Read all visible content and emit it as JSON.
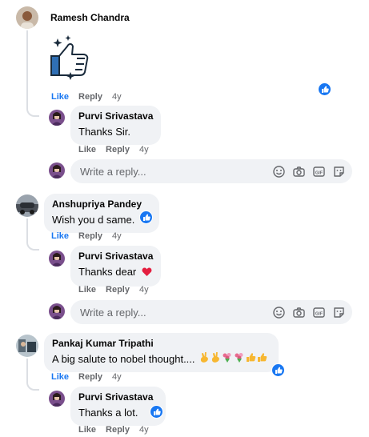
{
  "comments": [
    {
      "author": "Ramesh Chandra",
      "sticker": "thumbs-up-sparkle-sticker",
      "like": "Like",
      "reply": "Reply",
      "time": "4y",
      "replies": [
        {
          "author": "Purvi Srivastava",
          "text": "Thanks Sir.",
          "like": "Like",
          "reply": "Reply",
          "time": "4y"
        }
      ]
    },
    {
      "author": "Anshupriya Pandey",
      "text": "Wish you d same.",
      "like": "Like",
      "reply": "Reply",
      "time": "4y",
      "replies": [
        {
          "author": "Purvi Srivastava",
          "text": "Thanks dear",
          "like": "Like",
          "reply": "Reply",
          "time": "4y"
        }
      ]
    },
    {
      "author": "Pankaj Kumar Tripathi",
      "text": "A big salute to nobel thought....",
      "like": "Like",
      "reply": "Reply",
      "time": "4y",
      "replies": [
        {
          "author": "Purvi Srivastava",
          "text": "Thanks a lot.",
          "like": "Like",
          "reply": "Reply",
          "time": "4y"
        }
      ]
    }
  ],
  "reply_box": {
    "placeholder": "Write a reply..."
  },
  "colors": {
    "link": "#1877f2",
    "bubble": "#f0f2f5",
    "meta": "#65676b",
    "heart": "#e41e3f"
  },
  "icons": [
    "smile-icon",
    "camera-icon",
    "gif-icon",
    "sticker-icon",
    "like-reaction-icon",
    "heart-emoji",
    "victory-hand-emoji",
    "bouquet-emoji",
    "thumbs-up-emoji"
  ]
}
